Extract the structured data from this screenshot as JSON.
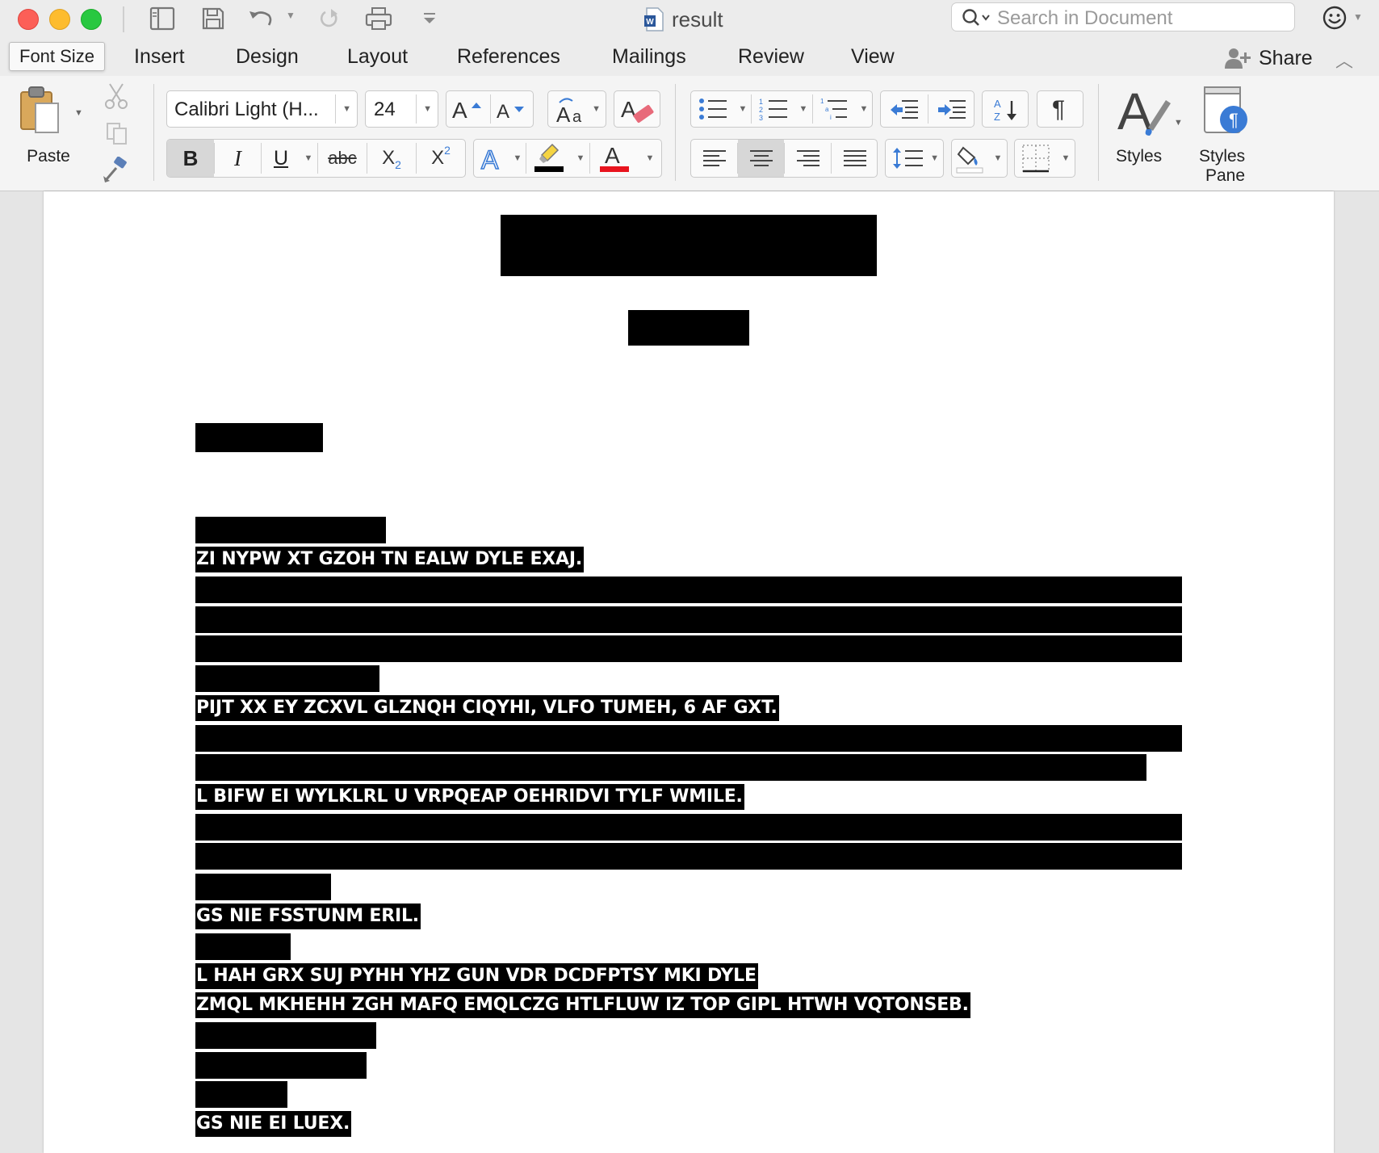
{
  "window": {
    "title": "result",
    "search_placeholder": "Search in Document",
    "traffic_lights": {
      "close": "#fc5f57",
      "minimize": "#fdbc2e",
      "zoom": "#28c840"
    }
  },
  "quick_access": {
    "icons": [
      "sidebar-icon",
      "save-icon",
      "undo-icon",
      "redo-icon",
      "print-icon",
      "customize-icon"
    ]
  },
  "tooltip": {
    "text": "Font Size"
  },
  "tabs": {
    "insert": "Insert",
    "design": "Design",
    "layout": "Layout",
    "references": "References",
    "mailings": "Mailings",
    "review": "Review",
    "view": "View"
  },
  "share": {
    "label": "Share"
  },
  "ribbon": {
    "paste_label": "Paste",
    "font_name": "Calibri Light (H...",
    "font_size": "24",
    "bold": "B",
    "italic": "I",
    "underline": "U",
    "strikethrough": "abc",
    "subscript_base": "X",
    "subscript_mark": "2",
    "superscript_base": "X",
    "superscript_mark": "2",
    "pilcrow": "¶",
    "styles_label": "Styles",
    "styles_pane_label_1": "Styles",
    "styles_pane_label_2": "Pane",
    "highlight_color": "#000000",
    "font_color": "#e8141e",
    "active_alignment": "center"
  },
  "document": {
    "visible_lines": [
      "ZI NYPW XT GZOH TN EALW DYLE EXAJ.",
      "PIJT XX EY ZCXVL GLZNQH CIQYHI, VLFO TUMEH, 6 AF GXT.",
      "L BIFW EI WYLKLRL U VRPQEAP OEHRIDVI TYLF WMILE.",
      "GS NIE FSSTUNM ERIL.",
      "L HAH GRX SUJ PYHH YHZ GUN VDR DCDFPTSY MKI DYLE",
      "ZMQL MKHEHH ZGH MAFQ EMQLCZG HTLFLUW IZ TOP GIPL HTWH VQTONSEB.",
      "GS NIE EI LUEX."
    ]
  }
}
